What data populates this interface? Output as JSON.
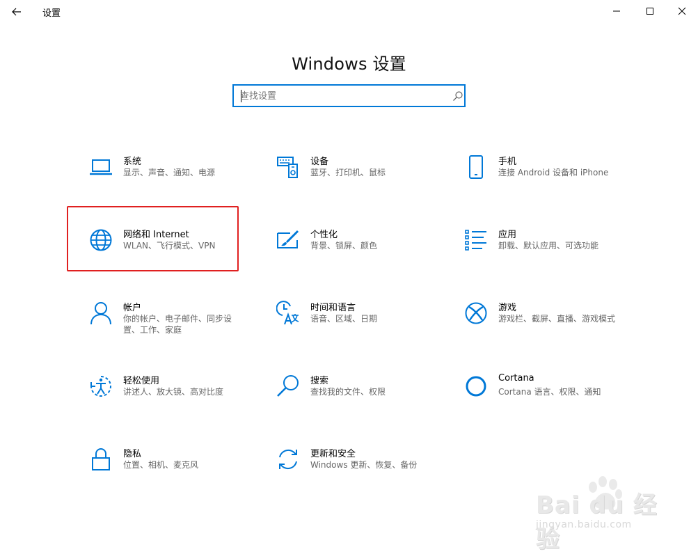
{
  "window": {
    "title": "设置",
    "icons": {
      "back": "back-arrow-icon",
      "minimize": "minimize-icon",
      "maximize": "maximize-icon",
      "close": "close-icon"
    }
  },
  "header": {
    "title": "Windows 设置"
  },
  "search": {
    "placeholder": "查找设置",
    "value": "",
    "icon": "search-icon"
  },
  "accent_color": "#0078d7",
  "highlight_color": "#e02020",
  "tiles": [
    {
      "label": "系统",
      "desc": "显示、声音、通知、电源",
      "icon": "laptop-icon"
    },
    {
      "label": "设备",
      "desc": "蓝牙、打印机、鼠标",
      "icon": "devices-keyboard-icon"
    },
    {
      "label": "手机",
      "desc": "连接 Android 设备和 iPhone",
      "icon": "phone-icon"
    },
    {
      "label": "网络和 Internet",
      "desc": "WLAN、飞行模式、VPN",
      "icon": "globe-icon"
    },
    {
      "label": "个性化",
      "desc": "背景、锁屏、颜色",
      "icon": "personalization-brush-icon"
    },
    {
      "label": "应用",
      "desc": "卸载、默认应用、可选功能",
      "icon": "apps-list-icon"
    },
    {
      "label": "帐户",
      "desc": "你的帐户、电子邮件、同步设置、工作、家庭",
      "icon": "person-icon"
    },
    {
      "label": "时间和语言",
      "desc": "语音、区域、日期",
      "icon": "time-language-icon"
    },
    {
      "label": "游戏",
      "desc": "游戏栏、截屏、直播、游戏模式",
      "icon": "xbox-icon"
    },
    {
      "label": "轻松使用",
      "desc": "讲述人、放大镜、高对比度",
      "icon": "ease-of-access-icon"
    },
    {
      "label": "搜索",
      "desc": "查找我的文件、权限",
      "icon": "search-magnifier-icon"
    },
    {
      "label": "Cortana",
      "desc": "Cortana 语言、权限、通知",
      "icon": "cortana-ring-icon"
    },
    {
      "label": "隐私",
      "desc": "位置、相机、麦克风",
      "icon": "lock-icon"
    },
    {
      "label": "更新和安全",
      "desc": "Windows 更新、恢复、备份",
      "icon": "update-sync-icon"
    }
  ],
  "watermark": {
    "main": "Bai du 经验",
    "sub": "jingyan.baidu.com"
  }
}
